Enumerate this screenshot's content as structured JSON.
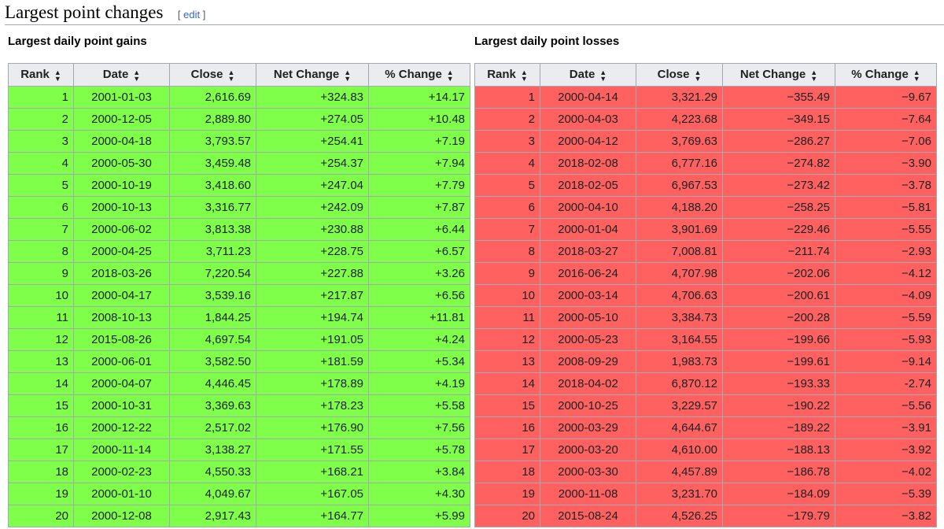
{
  "heading": {
    "title": "Largest point changes",
    "edit_open": "[ ",
    "edit_label": "edit",
    "edit_close": " ]"
  },
  "colors": {
    "gain_row": "#7fff4a",
    "loss_row": "#ff6161",
    "header_bg": "#eaecf0",
    "link": "#3366cc"
  },
  "gains": {
    "title": "Largest daily point gains",
    "columns": [
      "Rank",
      "Date",
      "Close",
      "Net Change",
      "% Change"
    ],
    "rows": [
      [
        "1",
        "2001-01-03",
        "2,616.69",
        "+324.83",
        "+14.17"
      ],
      [
        "2",
        "2000-12-05",
        "2,889.80",
        "+274.05",
        "+10.48"
      ],
      [
        "3",
        "2000-04-18",
        "3,793.57",
        "+254.41",
        "+7.19"
      ],
      [
        "4",
        "2000-05-30",
        "3,459.48",
        "+254.37",
        "+7.94"
      ],
      [
        "5",
        "2000-10-19",
        "3,418.60",
        "+247.04",
        "+7.79"
      ],
      [
        "6",
        "2000-10-13",
        "3,316.77",
        "+242.09",
        "+7.87"
      ],
      [
        "7",
        "2000-06-02",
        "3,813.38",
        "+230.88",
        "+6.44"
      ],
      [
        "8",
        "2000-04-25",
        "3,711.23",
        "+228.75",
        "+6.57"
      ],
      [
        "9",
        "2018-03-26",
        "7,220.54",
        "+227.88",
        "+3.26"
      ],
      [
        "10",
        "2000-04-17",
        "3,539.16",
        "+217.87",
        "+6.56"
      ],
      [
        "11",
        "2008-10-13",
        "1,844.25",
        "+194.74",
        "+11.81"
      ],
      [
        "12",
        "2015-08-26",
        "4,697.54",
        "+191.05",
        "+4.24"
      ],
      [
        "13",
        "2000-06-01",
        "3,582.50",
        "+181.59",
        "+5.34"
      ],
      [
        "14",
        "2000-04-07",
        "4,446.45",
        "+178.89",
        "+4.19"
      ],
      [
        "15",
        "2000-10-31",
        "3,369.63",
        "+178.23",
        "+5.58"
      ],
      [
        "16",
        "2000-12-22",
        "2,517.02",
        "+176.90",
        "+7.56"
      ],
      [
        "17",
        "2000-11-14",
        "3,138.27",
        "+171.55",
        "+5.78"
      ],
      [
        "18",
        "2000-02-23",
        "4,550.33",
        "+168.21",
        "+3.84"
      ],
      [
        "19",
        "2000-01-10",
        "4,049.67",
        "+167.05",
        "+4.30"
      ],
      [
        "20",
        "2000-12-08",
        "2,917.43",
        "+164.77",
        "+5.99"
      ]
    ]
  },
  "losses": {
    "title": "Largest daily point losses",
    "columns": [
      "Rank",
      "Date",
      "Close",
      "Net Change",
      "% Change"
    ],
    "rows": [
      [
        "1",
        "2000-04-14",
        "3,321.29",
        "−355.49",
        "−9.67"
      ],
      [
        "2",
        "2000-04-03",
        "4,223.68",
        "−349.15",
        "−7.64"
      ],
      [
        "3",
        "2000-04-12",
        "3,769.63",
        "−286.27",
        "−7.06"
      ],
      [
        "4",
        "2018-02-08",
        "6,777.16",
        "−274.82",
        "−3.90"
      ],
      [
        "5",
        "2018-02-05",
        "6,967.53",
        "−273.42",
        "−3.78"
      ],
      [
        "6",
        "2000-04-10",
        "4,188.20",
        "−258.25",
        "−5.81"
      ],
      [
        "7",
        "2000-01-04",
        "3,901.69",
        "−229.46",
        "−5.55"
      ],
      [
        "8",
        "2018-03-27",
        "7,008.81",
        "−211.74",
        "−2.93"
      ],
      [
        "9",
        "2016-06-24",
        "4,707.98",
        "−202.06",
        "−4.12"
      ],
      [
        "10",
        "2000-03-14",
        "4,706.63",
        "−200.61",
        "−4.09"
      ],
      [
        "11",
        "2000-05-10",
        "3,384.73",
        "−200.28",
        "−5.59"
      ],
      [
        "12",
        "2000-05-23",
        "3,164.55",
        "−199.66",
        "−5.93"
      ],
      [
        "13",
        "2008-09-29",
        "1,983.73",
        "−199.61",
        "−9.14"
      ],
      [
        "14",
        "2018-04-02",
        "6,870.12",
        "−193.33",
        "-2.74"
      ],
      [
        "15",
        "2000-10-25",
        "3,229.57",
        "−190.22",
        "−5.56"
      ],
      [
        "16",
        "2000-03-29",
        "4,644.67",
        "−189.22",
        "−3.91"
      ],
      [
        "17",
        "2000-03-20",
        "4,610.00",
        "−188.13",
        "−3.92"
      ],
      [
        "18",
        "2000-03-30",
        "4,457.89",
        "−186.78",
        "−4.02"
      ],
      [
        "19",
        "2000-11-08",
        "3,231.70",
        "−184.09",
        "−5.39"
      ],
      [
        "20",
        "2015-08-24",
        "4,526.25",
        "−179.79",
        "−3.82"
      ]
    ]
  }
}
